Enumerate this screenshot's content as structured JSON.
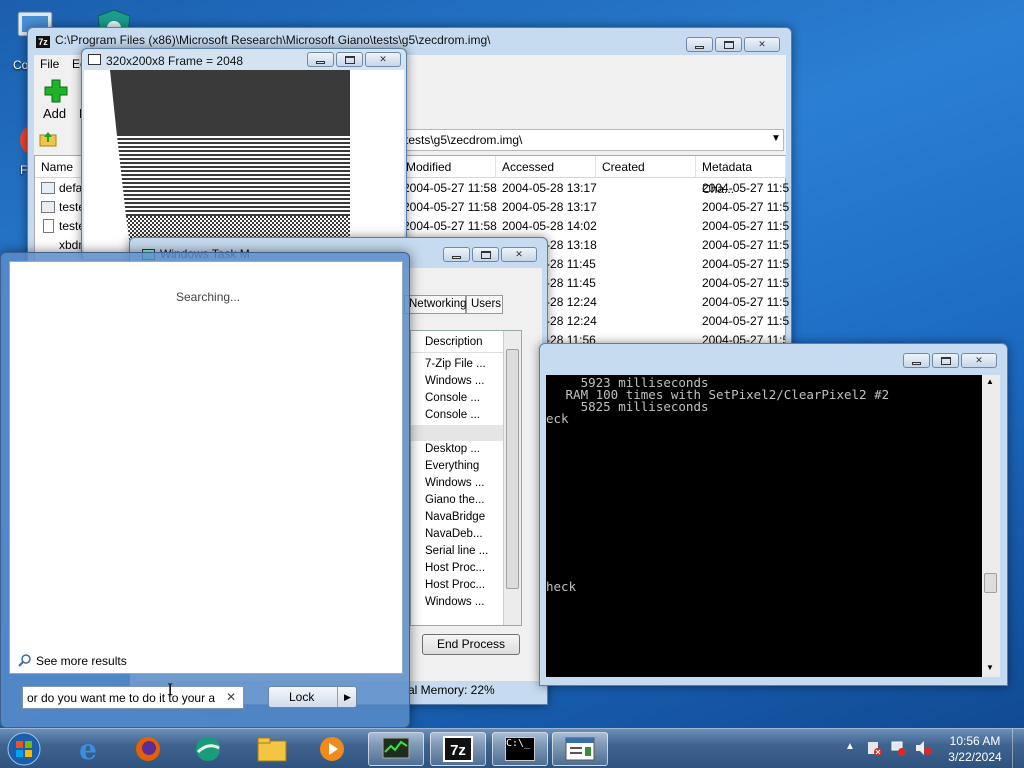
{
  "desktop": {
    "computer_label": "Co",
    "other_label": "F"
  },
  "sevenzip": {
    "title": "C:\\Program Files (x86)\\Microsoft Research\\Microsoft Giano\\tests\\g5\\zecdrom.img\\",
    "menu": [
      "File",
      "Ec"
    ],
    "toolbar": {
      "add": "Add",
      "extract": "E"
    },
    "address": "tests\\g5\\zecdrom.img\\",
    "columns": [
      "Name",
      "Modified",
      "Accessed",
      "Created",
      "Metadata Cha..."
    ],
    "rows": [
      {
        "name": "defa",
        "modified": "2004-05-27 11:58",
        "accessed": "2004-05-28 13:17",
        "created": "",
        "meta": "2004-05-27 11:5"
      },
      {
        "name": "teste",
        "modified": "2004-05-27 11:58",
        "accessed": "2004-05-28 13:17",
        "created": "",
        "meta": "2004-05-27 11:5"
      },
      {
        "name": "teste",
        "modified": "2004-05-27 11:58",
        "accessed": "2004-05-28 14:02",
        "created": "",
        "meta": "2004-05-27 11:5"
      },
      {
        "name": "xbdn",
        "modified": "",
        "accessed": "2004-05-28 13:18",
        "created": "",
        "meta": "2004-05-27 11:5"
      },
      {
        "name": "",
        "modified": "",
        "accessed": "2004-05-28 11:45",
        "created": "",
        "meta": "2004-05-27 11:5"
      },
      {
        "name": "",
        "modified": "",
        "accessed": "2004-05-28 11:45",
        "created": "",
        "meta": "2004-05-27 11:5"
      },
      {
        "name": "",
        "modified": "",
        "accessed": "2004-05-28 12:24",
        "created": "",
        "meta": "2004-05-27 11:5"
      },
      {
        "name": "",
        "modified": "",
        "accessed": "2004-05-28 12:24",
        "created": "",
        "meta": "2004-05-27 11:5"
      },
      {
        "name": "",
        "modified": "",
        "accessed": "2004-05-28 11:56",
        "created": "",
        "meta": "2004-05-27 11:5"
      }
    ]
  },
  "frame": {
    "title": "320x200x8 Frame = 2048"
  },
  "taskmgr": {
    "title": "Windows Task M",
    "tabs": [
      "Networking",
      "Users"
    ],
    "column": "Description",
    "items": [
      "7-Zip File ...",
      "Windows ...",
      "Console ...",
      "Console ...",
      "",
      "Desktop ...",
      "Everything",
      "Windows ...",
      "Giano the...",
      "NavaBridge",
      "NavaDeb...",
      "Serial line ...",
      "Host Proc...",
      "Host Proc...",
      "Windows ..."
    ],
    "end_process": "End Process",
    "status": "al Memory: 22%"
  },
  "console": {
    "lines": [
      "   5923 milliseconds",
      " RAM 100 times with SetPixel2/ClearPixel2 #2",
      "   5825 milliseconds",
      "eck",
      "heck"
    ]
  },
  "startmenu": {
    "searching": "Searching...",
    "see_more": "See more results",
    "search_value": "or do you want me to do it to your a",
    "lock": "Lock"
  },
  "taskbar": {
    "time": "10:56 AM",
    "date": "3/22/2024"
  }
}
